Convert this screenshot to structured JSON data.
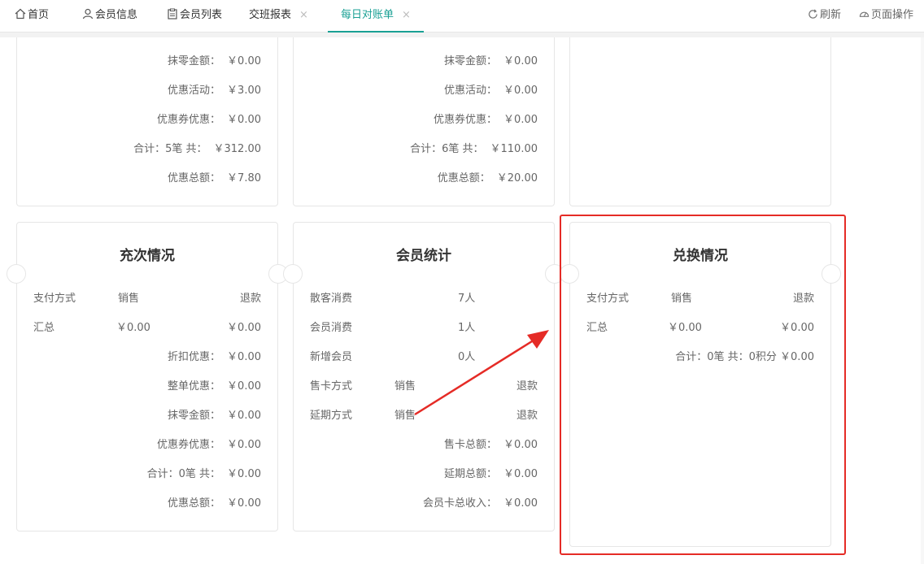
{
  "tabs": [
    {
      "label": "首页",
      "icon": "home-icon"
    },
    {
      "label": "会员信息",
      "icon": "user-icon"
    },
    {
      "label": "会员列表",
      "icon": "clipboard-icon"
    },
    {
      "label": "交班报表",
      "close": "×"
    },
    {
      "label": "每日对账单",
      "close": "×"
    }
  ],
  "header_actions": {
    "refresh": "刷新",
    "page_ops": "页面操作"
  },
  "top_cards": [
    {
      "rows": [
        {
          "label": "抹零金额：",
          "value": "￥0.00"
        },
        {
          "label": "优惠活动：",
          "value": "￥3.00"
        },
        {
          "label": "优惠券优惠：",
          "value": "￥0.00"
        },
        {
          "label": "合计：5笔 共：",
          "value": "￥312.00"
        },
        {
          "label": "优惠总额：",
          "value": "￥7.80"
        }
      ]
    },
    {
      "rows": [
        {
          "label": "抹零金额：",
          "value": "￥0.00"
        },
        {
          "label": "优惠活动：",
          "value": "￥0.00"
        },
        {
          "label": "优惠券优惠：",
          "value": "￥0.00"
        },
        {
          "label": "合计：6笔 共：",
          "value": "￥110.00"
        },
        {
          "label": "优惠总额：",
          "value": "￥20.00"
        }
      ]
    }
  ],
  "recharge": {
    "title": "充次情况",
    "headers": [
      "支付方式",
      "销售",
      "退款"
    ],
    "summary_row": [
      "汇总",
      "￥0.00",
      "￥0.00"
    ],
    "rows": [
      {
        "label": "折扣优惠：",
        "value": "￥0.00"
      },
      {
        "label": "整单优惠：",
        "value": "￥0.00"
      },
      {
        "label": "抹零金额：",
        "value": "￥0.00"
      },
      {
        "label": "优惠券优惠：",
        "value": "￥0.00"
      },
      {
        "label": "合计：0笔 共：",
        "value": "￥0.00"
      },
      {
        "label": "优惠总额：",
        "value": "￥0.00"
      }
    ]
  },
  "member_stats": {
    "title": "会员统计",
    "counts": [
      {
        "label": "散客消费",
        "value": "7人"
      },
      {
        "label": "会员消费",
        "value": "1人"
      },
      {
        "label": "新增会员",
        "value": "0人"
      }
    ],
    "methods": [
      {
        "label": "售卡方式",
        "sale": "销售",
        "refund": "退款"
      },
      {
        "label": "延期方式",
        "sale": "销售",
        "refund": "退款"
      }
    ],
    "rows": [
      {
        "label": "售卡总额：",
        "value": "￥0.00"
      },
      {
        "label": "延期总额：",
        "value": "￥0.00"
      },
      {
        "label": "会员卡总收入：",
        "value": "￥0.00"
      }
    ]
  },
  "exchange": {
    "title": "兑换情况",
    "headers": [
      "支付方式",
      "销售",
      "退款"
    ],
    "summary_row": [
      "汇总",
      "￥0.00",
      "￥0.00"
    ],
    "total": "合计：0笔 共：0积分 ￥0.00"
  },
  "colors": {
    "accent": "#1aa094",
    "highlight": "#e52b26"
  }
}
